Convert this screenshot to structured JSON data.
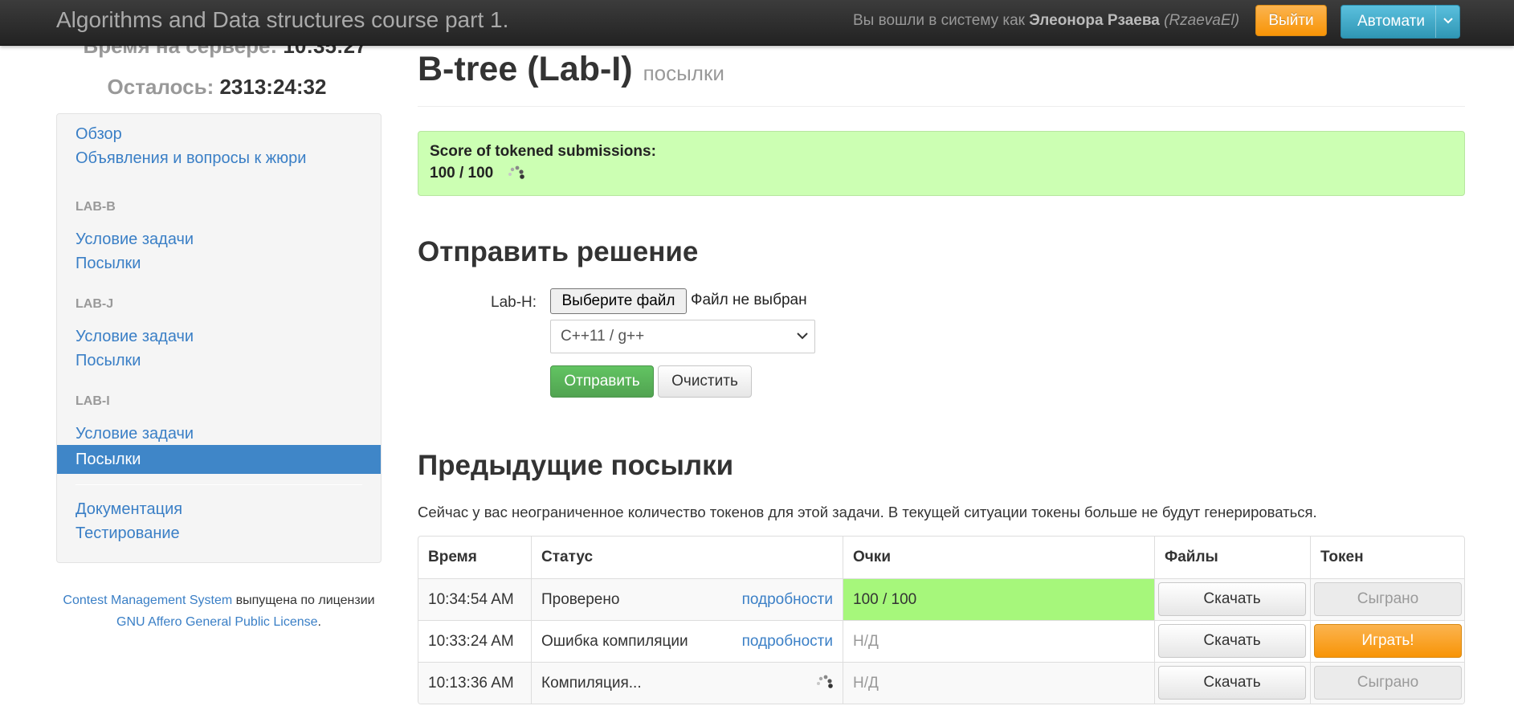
{
  "topbar": {
    "title": "Algorithms and Data structures course part 1.",
    "login_prefix": "Вы вошли в систему как",
    "user_name": "Элеонора Рзаева",
    "user_login": "(RzaevaEl)",
    "logout_label": "Выйти",
    "language_label": "Автомати"
  },
  "clock": {
    "server_time_label": "Время на сервере:",
    "server_time_value": "10:35:27",
    "remaining_label": "Осталось:",
    "remaining_value": "2313:24:32"
  },
  "sidebar": {
    "overview": "Обзор",
    "communication": "Объявления и вопросы к жюри",
    "groups": [
      {
        "header": "LAB-B",
        "statement": "Условие задачи",
        "submissions": "Посылки"
      },
      {
        "header": "LAB-J",
        "statement": "Условие задачи",
        "submissions": "Посылки"
      },
      {
        "header": "LAB-I",
        "statement": "Условие задачи",
        "submissions": "Посылки"
      }
    ],
    "documentation": "Документация",
    "testing": "Тестирование"
  },
  "license": {
    "cms_link": "Contest Management System",
    "text_middle": "выпущена по лицензии",
    "license_link": "GNU Affero General Public License",
    "period": "."
  },
  "page": {
    "title": "B-tree (Lab-I)",
    "subtitle": "посылки",
    "score_label": "Score of tokened submissions:",
    "score_value": "100 / 100"
  },
  "submit_form": {
    "heading": "Отправить решение",
    "file_label": "Lab-H:",
    "choose_file_label": "Выберите файл",
    "file_status": "Файл не выбран",
    "language_selected": "C++11 / g++",
    "submit_label": "Отправить",
    "reset_label": "Очистить"
  },
  "previous": {
    "heading": "Предыдущие посылки",
    "token_note": "Сейчас у вас неограниченное количество токенов для этой задачи. В текущей ситуации токены больше не будут генерироваться.",
    "columns": [
      "Время",
      "Статус",
      "Очки",
      "Файлы",
      "Токен"
    ],
    "rows": [
      {
        "time": "10:34:54 AM",
        "status": "Проверено",
        "details": "подробности",
        "score": "100 / 100",
        "files": "Скачать",
        "token": "Сыграно"
      },
      {
        "time": "10:33:24 AM",
        "status": "Ошибка компиляции",
        "details": "подробности",
        "score": "Н/Д",
        "files": "Скачать",
        "token": "Играть!"
      },
      {
        "time": "10:13:36 AM",
        "status": "Компиляция...",
        "details": "",
        "score": "Н/Д",
        "files": "Скачать",
        "token": "Сыграно"
      }
    ]
  },
  "colors": {
    "accent_blue": "#3f86c8",
    "score_success_bg": "#ccffb3",
    "full_score_cell": "#a6f77b",
    "orange_button": "#f89406",
    "green_button": "#51a351"
  }
}
